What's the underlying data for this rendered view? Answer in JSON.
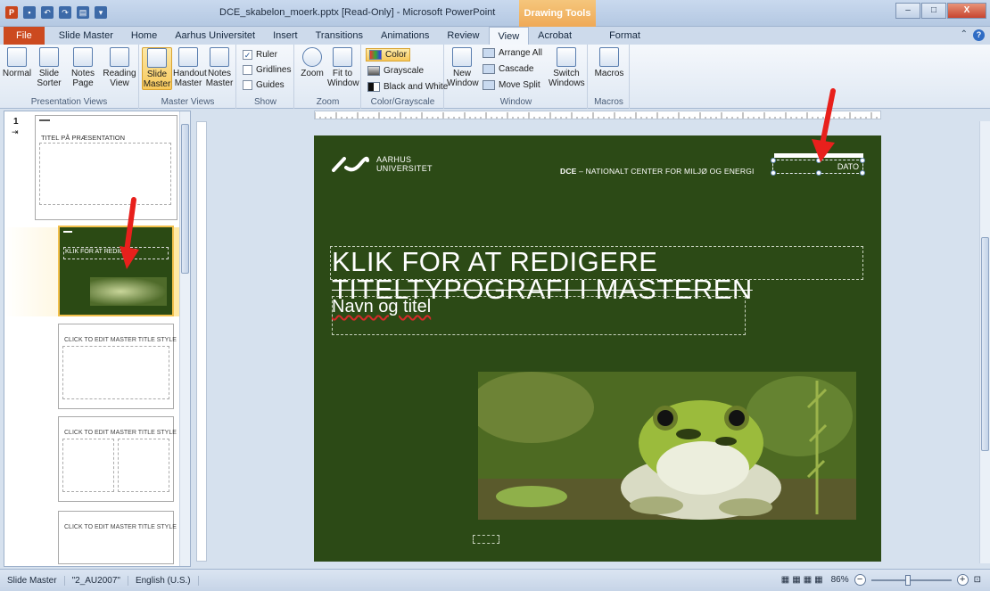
{
  "window": {
    "title": "DCE_skabelon_moerk.pptx [Read-Only] - Microsoft PowerPoint",
    "contextual_tab_group": "Drawing Tools",
    "minimize_label": "–",
    "restore_label": "□",
    "close_label": "X"
  },
  "tabs": [
    {
      "label": "File"
    },
    {
      "label": "Slide Master"
    },
    {
      "label": "Home"
    },
    {
      "label": "Aarhus Universitet"
    },
    {
      "label": "Insert"
    },
    {
      "label": "Transitions"
    },
    {
      "label": "Animations"
    },
    {
      "label": "Review"
    },
    {
      "label": "View"
    },
    {
      "label": "Acrobat"
    },
    {
      "label": "Format"
    }
  ],
  "active_tab": "View",
  "ribbon": {
    "presentation_views": {
      "label": "Presentation Views",
      "normal": "Normal",
      "slide_sorter": "Slide Sorter",
      "notes_page": "Notes Page",
      "reading_view": "Reading View"
    },
    "master_views": {
      "label": "Master Views",
      "slide_master": "Slide Master",
      "handout_master": "Handout Master",
      "notes_master": "Notes Master"
    },
    "show": {
      "label": "Show",
      "ruler": "Ruler",
      "gridlines": "Gridlines",
      "guides": "Guides",
      "ruler_checked": true
    },
    "zoom": {
      "label": "Zoom",
      "zoom": "Zoom",
      "fit_to_window": "Fit to Window"
    },
    "color_grayscale": {
      "label": "Color/Grayscale",
      "color": "Color",
      "grayscale": "Grayscale",
      "black_and_white": "Black and White"
    },
    "window_group": {
      "label": "Window",
      "new_window": "New Window",
      "arrange_all": "Arrange All",
      "cascade": "Cascade",
      "move_split": "Move Split",
      "switch_windows": "Switch Windows"
    },
    "macros": {
      "label": "Macros",
      "macros": "Macros"
    }
  },
  "thumbnails": [
    {
      "number": "1",
      "title": "TITEL PÅ PRÆSENTATION"
    },
    {
      "number": "",
      "title": "KLIK FOR AT REDIGERE"
    },
    {
      "number": "",
      "title": "CLICK TO EDIT MASTER TITLE STYLE"
    },
    {
      "number": "",
      "title": "CLICK TO EDIT MASTER TITLE STYLE"
    },
    {
      "number": "",
      "title": "CLICK TO EDIT MASTER TITLE STYLE"
    }
  ],
  "slide": {
    "logo_line1": "AARHUS",
    "logo_line2": "UNIVERSITET",
    "header_bold": "DCE",
    "header_rest": " – NATIONALT CENTER FOR MILJØ OG ENERGI",
    "date": "DATO",
    "title_line1": "KLIK FOR AT REDIGERE",
    "title_line2": "TITELTYPOGRAFI I MASTEREN",
    "subtitle": "Navn og titel",
    "background_color": "#2c4a16"
  },
  "status": {
    "view": "Slide Master",
    "theme": "\"2_AU2007\"",
    "language": "English (U.S.)",
    "zoom": "86%"
  },
  "colors": {
    "arrow": "#e8201c",
    "file_tab": "#cc4a1f",
    "drawing_tools": "#efa956"
  }
}
